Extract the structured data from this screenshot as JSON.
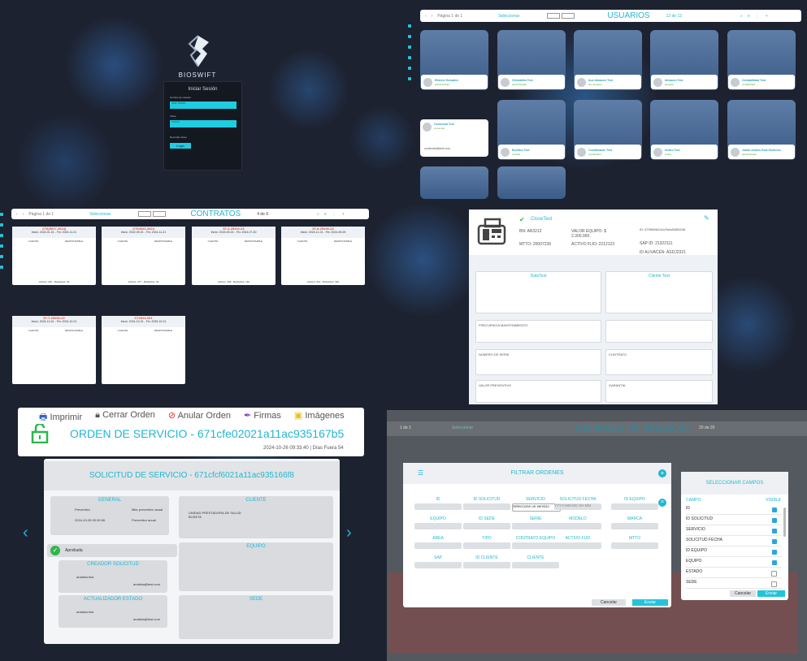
{
  "login": {
    "brand": "BIOSWIFT",
    "title": "Iniciar Sesión",
    "user_label": "Nombre de Usuario",
    "user_value": "user Admin",
    "pass_label": "Clave",
    "pass_value": "••••••••",
    "remember_label": "Recordar Clave",
    "login_button": "Login"
  },
  "users": {
    "pagination": "Página 1 de 1",
    "select_all": "Seleccionar",
    "title": "USUARIOS",
    "count": "12 de 12",
    "cards": [
      {
        "name": "Etienne Gonzalez",
        "role": "administrador"
      },
      {
        "name": "Clinicaltim Test",
        "role": "administrador"
      },
      {
        "name": "Aux Almacen Test",
        "role": "aux almacen"
      },
      {
        "name": "Almacen Test",
        "role": "almacen"
      },
      {
        "name": "Contabilidad Test",
        "role": "contabilidad"
      },
      {
        "name": "Comercial Test",
        "role": "comercial"
      },
      {
        "name": "Ecofisio Test",
        "role": "ecofisio"
      },
      {
        "name": "Coordinador Test",
        "role": "coordinador"
      },
      {
        "name": "Invitro Test",
        "role": "invitro"
      },
      {
        "name": "Johan Andres Ruiz Gutierrez",
        "role": "administrador"
      }
    ],
    "comercial_email": "comercial@test.com"
  },
  "contracts": {
    "pagination": "Página 1 de 1",
    "select_all": "Seleccionar",
    "title": "CONTRATOS",
    "count": "4 de 6",
    "cards": [
      {
        "id": "CT6(5017-2024)",
        "dates": "Inicio: 2024-01-01 - Fin: 2024-11-21",
        "client": "CLIENTE",
        "resp": "RESPONSABLE",
        "foot": "Activos: 243 - Restantes: 26"
      },
      {
        "id": "CT62022-2024",
        "dates": "Inicio: 2022-09-01 - Fin: 2024-11-21",
        "client": "CLIENTE",
        "resp": "RESPONSABLE",
        "foot": "Activos: 377 - Restantes: 40"
      },
      {
        "id": "97-2-25102-23",
        "dates": "Inicio: 2023-05-02 - Fin: 2024-07-30",
        "client": "CLIENTE",
        "resp": "RESPONSABLE",
        "foot": "Activos: 449 - Restantes: 142"
      },
      {
        "id": "97-8-25106-23",
        "dates": "Inicio: 2024-11-01 - Fin: 2024-09-09",
        "client": "CLIENTE",
        "resp": "RESPONSABLE",
        "foot": "Activos: 414 - Restantes: 304"
      },
      {
        "id": "97-7-25206-23",
        "dates": "Inicio: 2024-10-01 - Fin: 2024-10-01",
        "client": "CLIENTE",
        "resp": "RESPONSABLE",
        "foot": ""
      },
      {
        "id": "CT2024-001",
        "dates": "Inicio: 2024-10-01 - Fin: 2025-10-01",
        "client": "CLIENTE",
        "resp": "RESPONSABLE",
        "foot": ""
      }
    ]
  },
  "device": {
    "name": "CloseTest",
    "bn": "BN: AR3212",
    "valor": "VALOR EQUIPO: $ 2.300.000",
    "id": "ID: 6708d56414a7bdaf1855246",
    "mtto": "MTTO: 20007236",
    "activo": "ACTIVO FIJO: 2212123",
    "sap": "SAP ID: 21322111",
    "alias": "ID ALIVACÉN: ASDJ2321",
    "sede": "DataTest",
    "cliente": "Cliente Test",
    "frecuencia": "FRECUENCIA MANTENIMIENTO",
    "serie": "NÚMERO DE SERIE",
    "contrato": "CONTRATO",
    "preventivo": "VALOR PREVENTIVO",
    "garantia": "GARANTÍA"
  },
  "order": {
    "actions": {
      "print": "Imprimir",
      "close": "Cerrar Orden",
      "cancel": "Anular Orden",
      "sign": "Firmas",
      "images": "Imágenes"
    },
    "title": "ORDEN DE SERVICIO - 671cfe02021a11ac935167b5",
    "date": "2024-10-26 09:33:40 | Días Fuera 54",
    "request_title": "SOLICITUD DE SERVICIO - 671cfcf6021a11ac935166f8",
    "general": "GENERAL",
    "cliente": "CLIENTE",
    "equipo": "EQUIPO",
    "sede": "SEDE",
    "creator": "CREADOR SOLICITUD",
    "updater": "ACTUALIZADOR ESTADO",
    "approved": "Aprobada",
    "prev1": "Preventivo",
    "prev2": "Mtto preventivo anual",
    "date2": "2024-10-26 09:30:06",
    "prev3": "Preventivo anual",
    "client_name": "UNIDAD PRESTADORA DE SALUD BOSETA",
    "creator_name": "analista test",
    "creator_email": "analista@test.com",
    "updater_name": "analista test",
    "updater_email": "analista@test.com"
  },
  "orders_bg": {
    "title": "ORDENES DE SERVICIO",
    "pagination": "1 de 1",
    "select": "Seleccionar",
    "count": "20 de 20"
  },
  "filter": {
    "title": "FILTRAR ORDENES",
    "fields": [
      "ID",
      "ID SOLICITUD",
      "SERVICIO",
      "SOLICITUD FECHA",
      "ID EQUIPO",
      "EQUIPO",
      "ID SEDE",
      "SERIE",
      "MODELO",
      "MARCA",
      "ÁREA",
      "TIPO",
      "CONTRATO EQUIPO",
      "ACTIVO FIJO",
      "MTTO",
      "SAP",
      "ID CLIENTE",
      "CLIENTE"
    ],
    "servicio_placeholder": "Seleccione un servicio",
    "fecha_placeholder": "YYYY-MM-DD HH:MM",
    "cancel": "Cancelar",
    "send": "Enviar"
  },
  "select_fields": {
    "title": "SELECCIONAR CAMPOS",
    "col1": "CAMPO",
    "col2": "VISIBLE",
    "rows": [
      {
        "name": "ID",
        "on": true
      },
      {
        "name": "ID SOLICITUD",
        "on": true
      },
      {
        "name": "SERVICIO",
        "on": true
      },
      {
        "name": "SOLICITUD FECHA",
        "on": true
      },
      {
        "name": "ID EQUIPO",
        "on": true
      },
      {
        "name": "EQUIPO",
        "on": true
      },
      {
        "name": "ESTADO",
        "on": false
      },
      {
        "name": "SEDE",
        "on": false
      }
    ],
    "cancel": "Cancelar",
    "send": "Enviar"
  }
}
